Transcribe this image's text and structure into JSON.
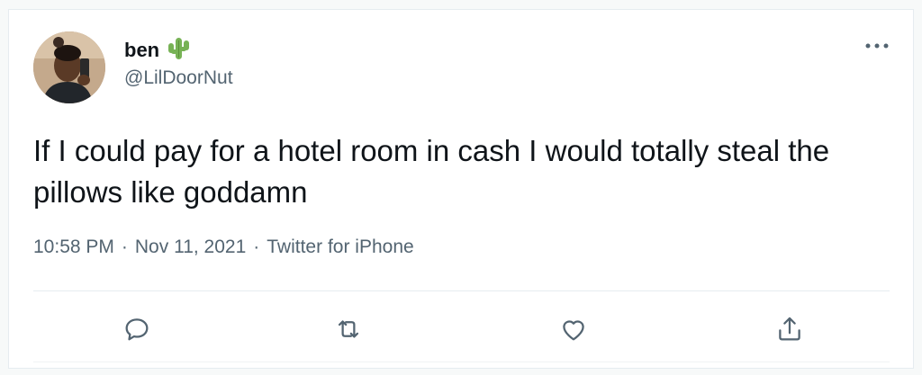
{
  "tweet": {
    "author": {
      "display_name": "ben",
      "handle": "@LilDoorNut",
      "emoji_icon": "cactus-icon"
    },
    "text": "If I could pay for a hotel room in cash I would totally steal the pillows like goddamn",
    "time": "10:58 PM",
    "date": "Nov 11, 2021",
    "source": "Twitter for iPhone",
    "separator": "·",
    "actions": [
      {
        "name": "reply",
        "icon": "speech-bubble-icon"
      },
      {
        "name": "retweet",
        "icon": "retweet-icon"
      },
      {
        "name": "like",
        "icon": "heart-icon"
      },
      {
        "name": "share",
        "icon": "share-icon"
      }
    ]
  },
  "colors": {
    "text_primary": "#0f1419",
    "text_secondary": "#536471",
    "divider": "#e6ecf0",
    "background": "#ffffff"
  }
}
